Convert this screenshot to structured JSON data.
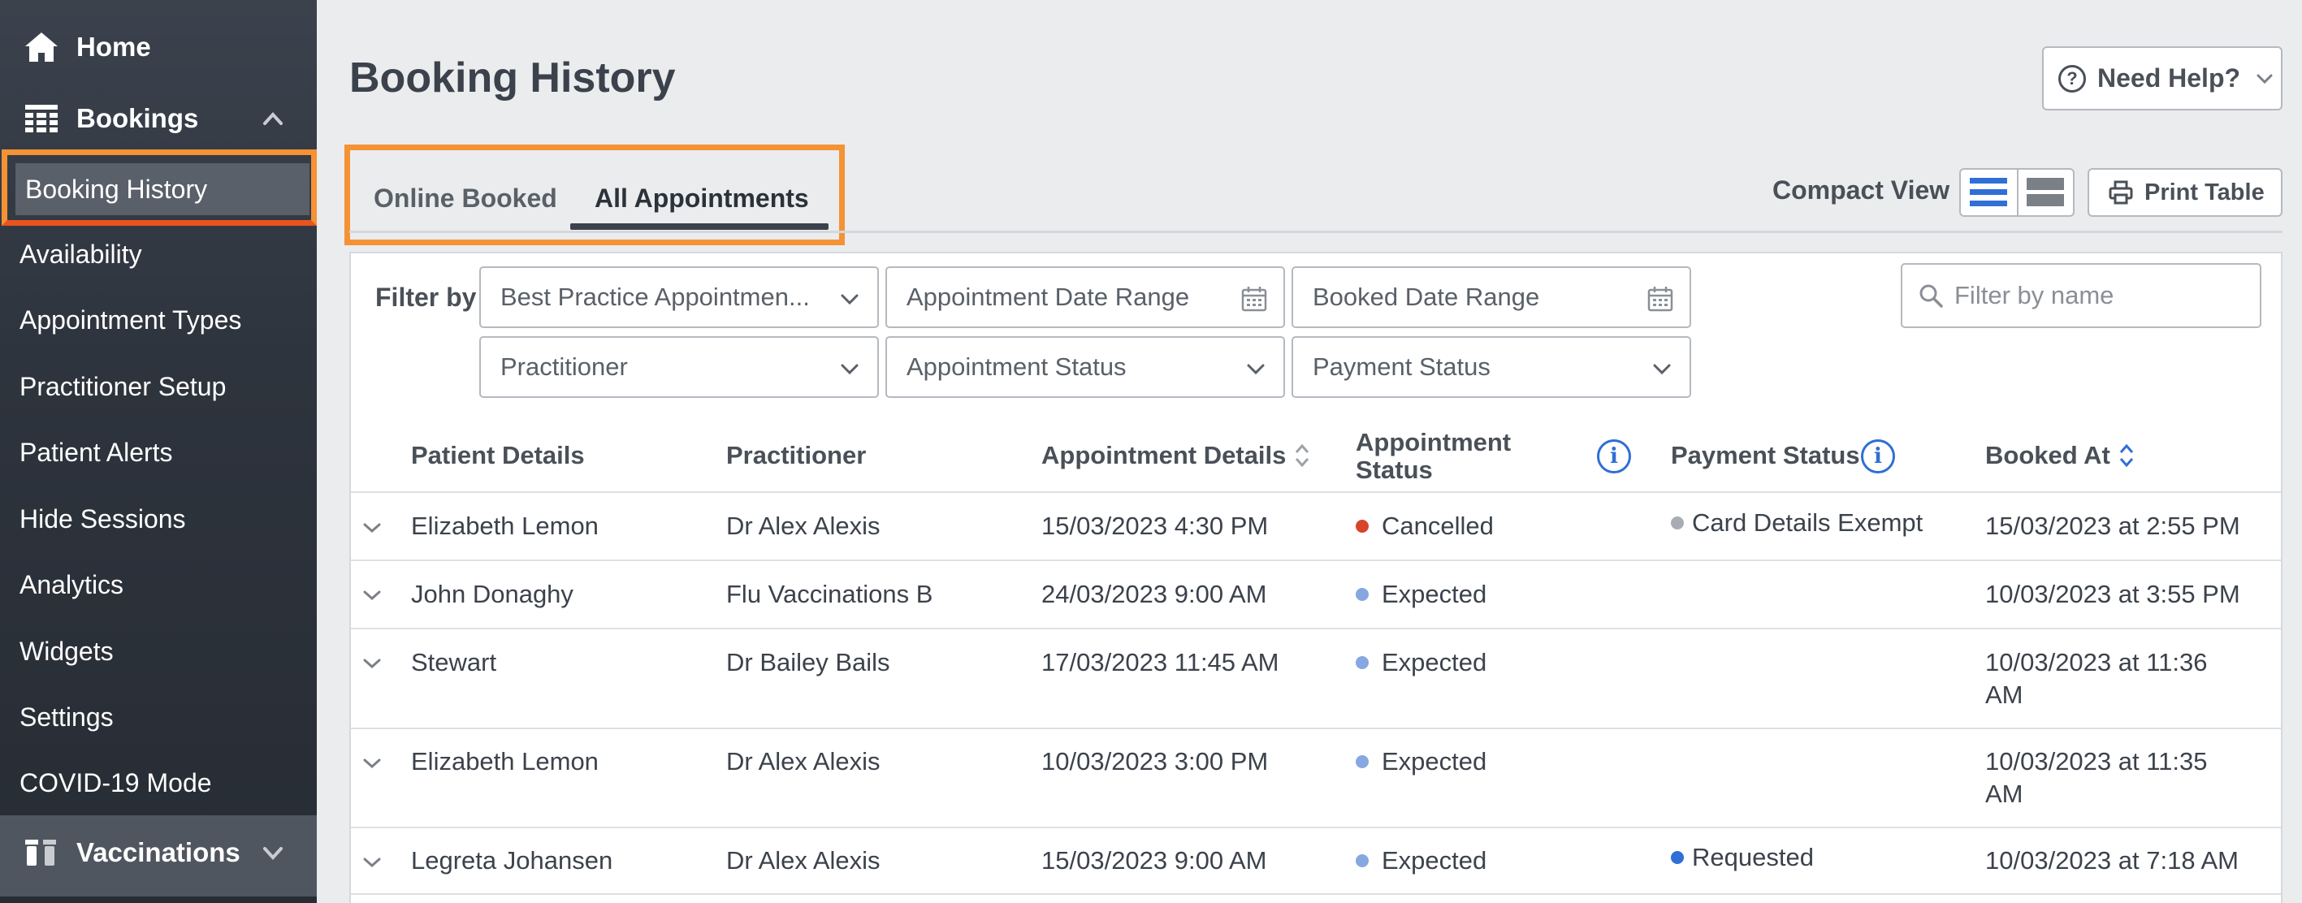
{
  "sidebar": {
    "home": "Home",
    "bookings": "Bookings",
    "items": [
      {
        "label": "Booking History"
      },
      {
        "label": "Availability"
      },
      {
        "label": "Appointment Types"
      },
      {
        "label": "Practitioner Setup"
      },
      {
        "label": "Patient Alerts"
      },
      {
        "label": "Hide Sessions"
      },
      {
        "label": "Analytics"
      },
      {
        "label": "Widgets"
      },
      {
        "label": "Settings"
      },
      {
        "label": "COVID-19 Mode"
      }
    ],
    "vaccinations": "Vaccinations"
  },
  "header": {
    "title": "Booking History",
    "help": "Need Help?"
  },
  "tabs": [
    {
      "label": "Online Booked"
    },
    {
      "label": "All Appointments",
      "active": true
    }
  ],
  "toolbar": {
    "compact_view": "Compact View",
    "print": "Print Table"
  },
  "filters": {
    "label": "Filter by",
    "source": "Best Practice Appointmen...",
    "appointment_date": "Appointment Date Range",
    "booked_date": "Booked Date Range",
    "practitioner": "Practitioner",
    "appointment_status": "Appointment Status",
    "payment_status": "Payment Status",
    "search_placeholder": "Filter by name"
  },
  "table": {
    "columns": {
      "patient": "Patient Details",
      "practitioner": "Practitioner",
      "appointment": "Appointment Details",
      "status_line1": "Appointment",
      "status_line2": "Status",
      "payment": "Payment Status",
      "booked": "Booked At"
    },
    "rows": [
      {
        "patient": "Elizabeth Lemon",
        "practitioner": "Dr Alex Alexis",
        "appointment": "15/03/2023 4:30 PM",
        "status": "Cancelled",
        "payment": "Card Details Exempt",
        "booked_l1": "15/03/2023 at 2:55 PM",
        "booked_l2": ""
      },
      {
        "patient": "John Donaghy",
        "practitioner": "Flu Vaccinations B",
        "appointment": "24/03/2023 9:00 AM",
        "status": "Expected",
        "payment": "",
        "booked_l1": "10/03/2023 at 3:55 PM",
        "booked_l2": ""
      },
      {
        "patient": "Stewart",
        "practitioner": "Dr Bailey Bails",
        "appointment": "17/03/2023 11:45 AM",
        "status": "Expected",
        "payment": "",
        "booked_l1": "10/03/2023 at 11:36",
        "booked_l2": "AM"
      },
      {
        "patient": "Elizabeth Lemon",
        "practitioner": "Dr Alex Alexis",
        "appointment": "10/03/2023 3:00 PM",
        "status": "Expected",
        "payment": "",
        "booked_l1": "10/03/2023 at 11:35",
        "booked_l2": "AM"
      },
      {
        "patient": "Legreta Johansen",
        "practitioner": "Dr Alex Alexis",
        "appointment": "15/03/2023 9:00 AM",
        "status": "Expected",
        "payment": "Requested",
        "booked_l1": "10/03/2023 at 7:18 AM",
        "booked_l2": ""
      }
    ]
  },
  "colors": {
    "highlight": "#f49234",
    "cancelled": "#d8432c",
    "expected": "#86a7e0",
    "exempt": "#a9adb3",
    "requested": "#2f6fd6",
    "accent": "#2f6fd6"
  }
}
